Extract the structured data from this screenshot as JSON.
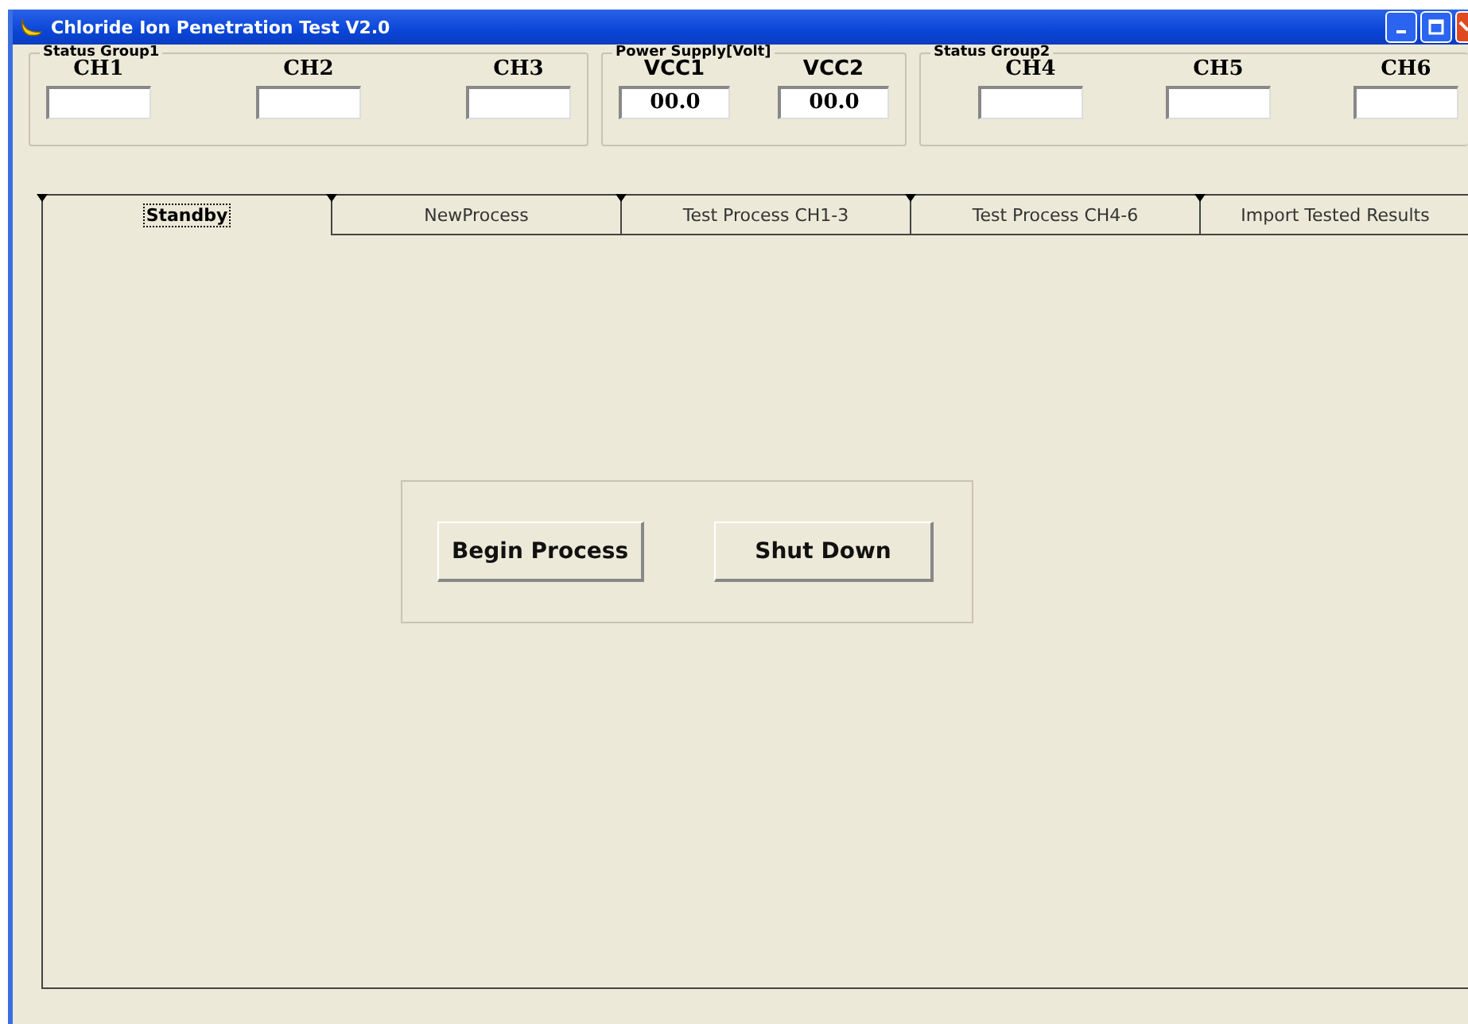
{
  "window": {
    "title": "Chloride Ion Penetration Test V2.0"
  },
  "status_group1": {
    "title": "Status Group1",
    "channels": [
      {
        "label": "CH1"
      },
      {
        "label": "CH2"
      },
      {
        "label": "CH3"
      }
    ]
  },
  "power_supply": {
    "title": "Power Supply[Volt]",
    "channels": [
      {
        "label": "VCC1",
        "value": "00.0"
      },
      {
        "label": "VCC2",
        "value": "00.0"
      }
    ]
  },
  "status_group2": {
    "title": "Status Group2",
    "channels": [
      {
        "label": "CH4"
      },
      {
        "label": "CH5"
      },
      {
        "label": "CH6"
      }
    ]
  },
  "tabs": [
    {
      "label": "Standby",
      "selected": true
    },
    {
      "label": "NewProcess",
      "selected": false
    },
    {
      "label": "Test Process CH1-3",
      "selected": false
    },
    {
      "label": "Test Process CH4-6",
      "selected": false
    },
    {
      "label": "Import Tested Results",
      "selected": false
    }
  ],
  "buttons": [
    "Begin Process",
    "Shut Down"
  ]
}
